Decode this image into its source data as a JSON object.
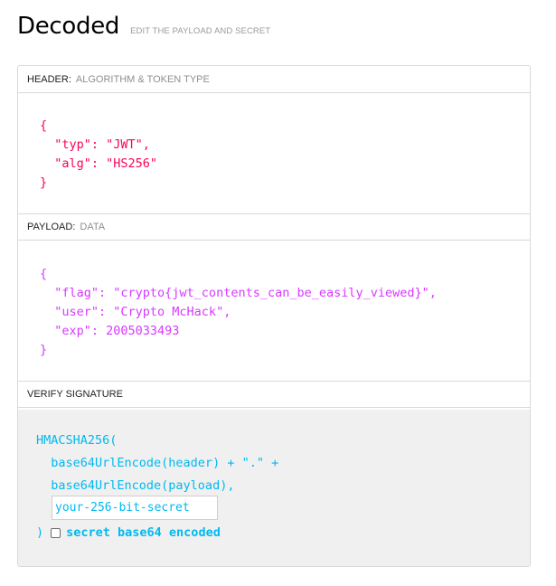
{
  "page": {
    "title": "Decoded",
    "subtitle": "EDIT THE PAYLOAD AND SECRET"
  },
  "header_section": {
    "label": "HEADER:",
    "sublabel": "ALGORITHM & TOKEN TYPE",
    "json_text": "{\n  \"typ\": \"JWT\",\n  \"alg\": \"HS256\"\n}",
    "color": "#fb015b"
  },
  "payload_section": {
    "label": "PAYLOAD:",
    "sublabel": "DATA",
    "json_text": "{\n  \"flag\": \"crypto{jwt_contents_can_be_easily_viewed}\",\n  \"user\": \"Crypto McHack\",\n  \"exp\": 2005033493\n}",
    "color": "#d63aff"
  },
  "verify_section": {
    "label": "VERIFY SIGNATURE",
    "code_text": "HMACSHA256(\n  base64UrlEncode(header) + \".\" +\n  base64UrlEncode(payload),",
    "secret_placeholder": "your-256-bit-secret",
    "secret_value": "",
    "close_paren": ")",
    "checkbox_label": "secret base64 encoded",
    "checkbox_checked": false,
    "color": "#00b9f1"
  }
}
